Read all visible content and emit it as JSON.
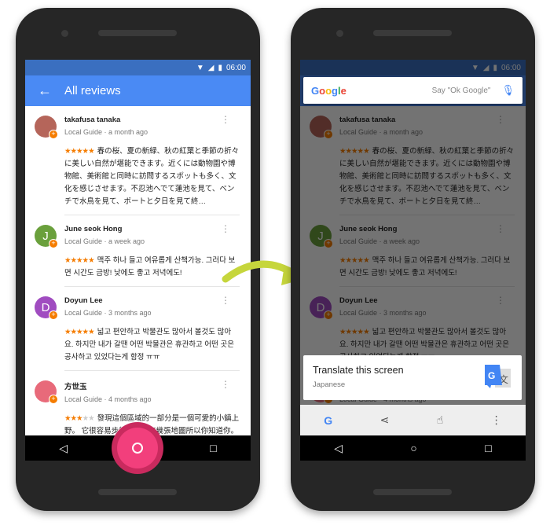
{
  "status": {
    "time": "06:00"
  },
  "left": {
    "title": "All reviews"
  },
  "reviews": [
    {
      "name": "takafusa tanaka",
      "meta": "Local Guide · a month ago",
      "stars": 5,
      "text": "春の桜、夏の新緑、秋の紅葉と季節の折々に美しい自然が堪能できます。近くには動物園や博物館、美術館と同時に訪問するスポットも多く、文化を感じさせます。不忍池へでて蓮池を見て、ベンチで水鳥を見て、ボートと夕日を見て終…",
      "avatar": "",
      "avatar_color": "#b5655a"
    },
    {
      "name": "June seok Hong",
      "meta": "Local Guide · a week ago",
      "stars": 5,
      "text": "맥주 하나 들고 여유롭게 산책가능. 그러다 보면 시간도 금방! 낮에도 좋고 저녁에도!",
      "avatar": "J",
      "avatar_color": "#6aa03c"
    },
    {
      "name": "Doyun Lee",
      "meta": "Local Guide · 3 months ago",
      "stars": 5,
      "text": "넓고 편안하고 박물관도 많아서 볼것도 많아요. 하지만 내가 갈땐 어떤 박물관은 휴관하고 어떤 곳은 공사하고 있었다는게 함정 ㅠㅠ",
      "avatar": "D",
      "avatar_color": "#a04cc0"
    },
    {
      "name": "方世玉",
      "meta": "Local Guide · 4 months ago",
      "stars": 3,
      "text": "發現這個區域的一部分是一個可愛的小鎮上野。 它很容易步行去周圍有幾張地圖所以你知道你。 沿途可以看到有趣的東西和一個不錯的地方",
      "avatar": "",
      "avatar_color": "#e86a7a"
    }
  ],
  "right": {
    "search_logo": "Google",
    "search_hint": "Say \"Ok Google\"",
    "card_title": "Translate this screen",
    "card_subtitle": "Japanese"
  },
  "colors": {
    "appbar": "#4a8af4",
    "accent": "#f57c00",
    "fab": "#f23f7c",
    "arrow": "#c6d63c"
  },
  "icons": [
    "back-arrow-icon",
    "more-vert-icon",
    "mic-icon",
    "translate-icon",
    "google-g-icon",
    "share-icon",
    "touch-icon",
    "nav-back-icon",
    "nav-home-icon",
    "nav-recents-icon"
  ]
}
